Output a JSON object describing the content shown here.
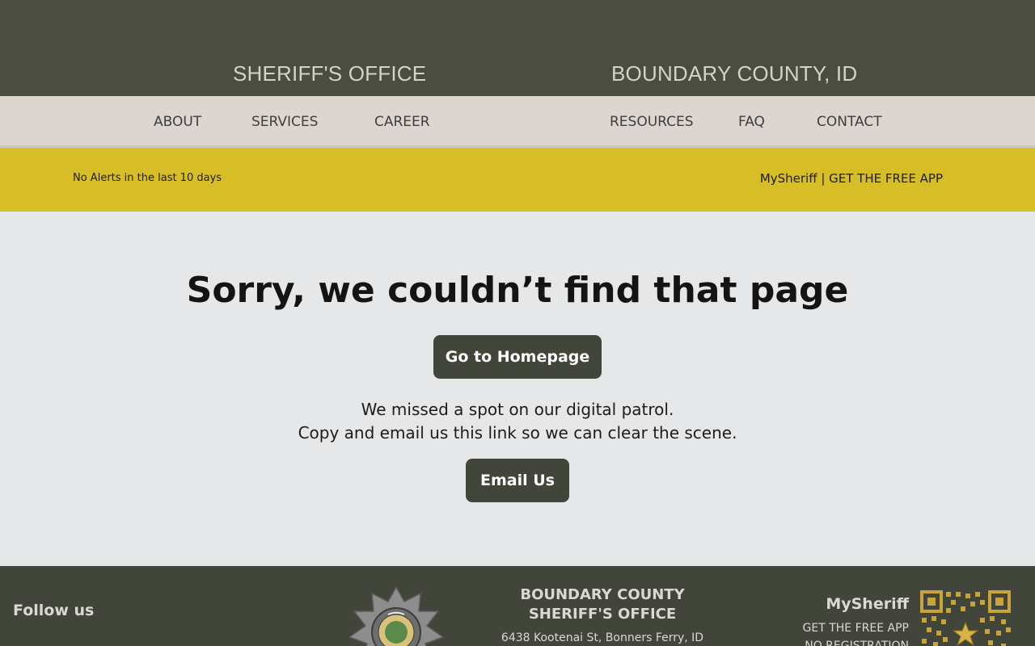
{
  "header": {
    "left_title": "SHERIFF'S OFFICE",
    "right_title": "BOUNDARY COUNTY, ID"
  },
  "nav": {
    "items": [
      {
        "label": "ABOUT"
      },
      {
        "label": "SERVICES"
      },
      {
        "label": "CAREER"
      },
      {
        "label": "RESOURCES"
      },
      {
        "label": "FAQ"
      },
      {
        "label": "CONTACT"
      }
    ]
  },
  "alert_bar": {
    "status": "No Alerts in the last 10 days",
    "app_link": "MySheriff | GET THE FREE APP"
  },
  "main": {
    "title": "Sorry, we couldn’t find that page",
    "home_button": "Go to Homepage",
    "message_line1": "We missed a spot on our digital patrol.",
    "message_line2": "Copy and email us this link so we can clear the scene.",
    "email_button": "Email Us"
  },
  "footer": {
    "follow_label": "Follow us",
    "org_name": "BOUNDARY COUNTY SHERIFF'S OFFICE",
    "address": "6438 Kootenai St, Bonners Ferry, ID",
    "app_title": "MySheriff",
    "app_line1": "GET THE FREE APP",
    "app_line2": "NO REGISTRATION",
    "badge_icon": "sheriff-badge-icon",
    "qr_icon": "qr-code-icon"
  },
  "colors": {
    "header_bg": "#4a4d40",
    "nav_bg": "#ddd5cf",
    "alert_bg": "#d7be27",
    "button_bg": "#42463a",
    "footer_bg": "#42463a",
    "qr_gold": "#c9a43a"
  }
}
